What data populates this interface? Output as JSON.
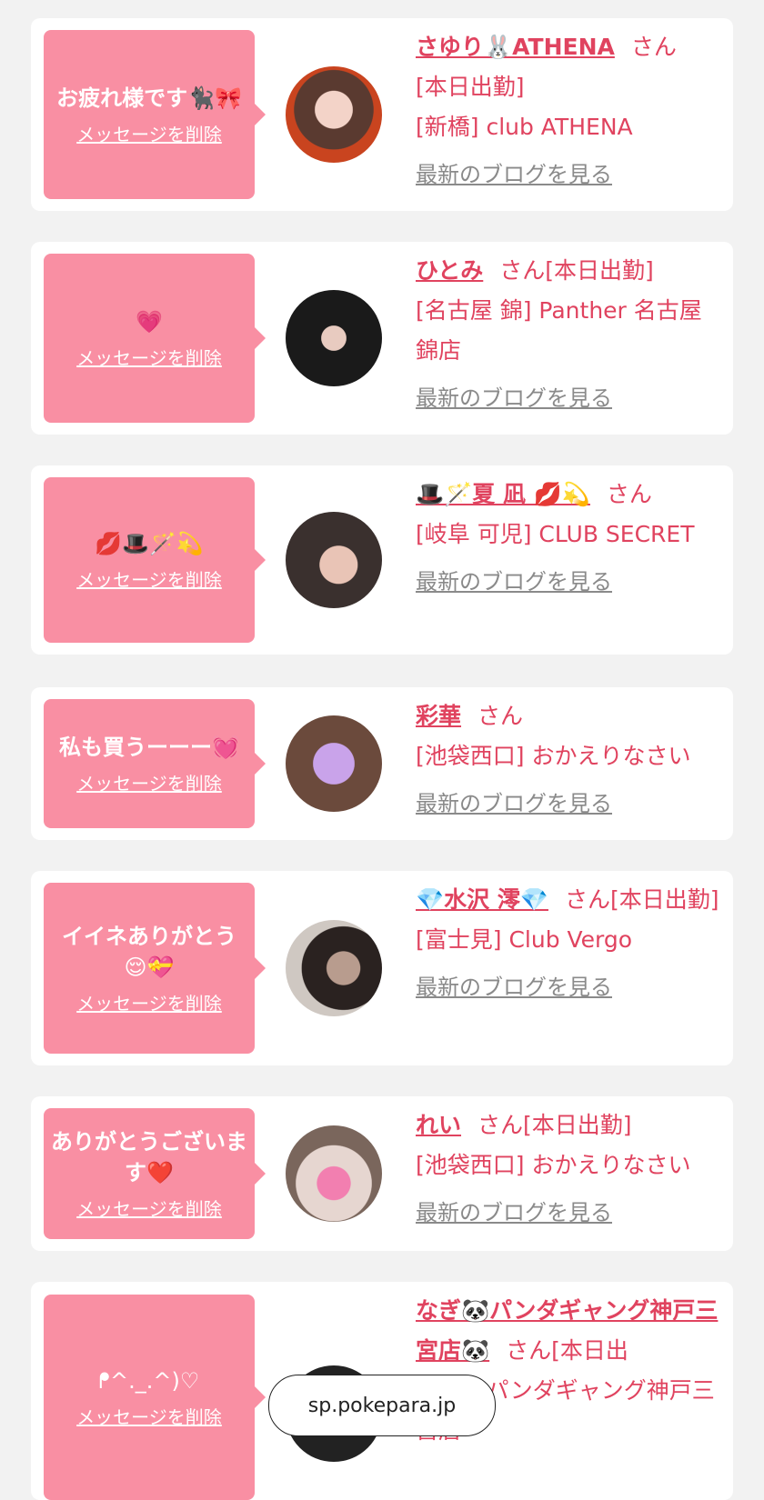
{
  "delete_label": "メッセージを削除",
  "blog_label": "最新のブログを見る",
  "san": "さん",
  "url": "sp.pokepara.jp",
  "cards": [
    {
      "message": "お疲れ様です🐈‍⬛🎀",
      "name": "さゆり🐰ATHENA",
      "status": "[本日出勤]",
      "shop": "[新橋] club ATHENA"
    },
    {
      "message": "💗",
      "name": "ひとみ",
      "status": "[本日出勤]",
      "shop": "[名古屋 錦] Panther 名古屋錦店"
    },
    {
      "message": "💋🎩🪄💫",
      "name": "🎩🪄夏 凪 💋💫",
      "status": "",
      "shop": "[岐阜 可児] CLUB SECRET"
    },
    {
      "message": "私も買うーーー💓",
      "name": "彩華",
      "status": "",
      "shop": "[池袋西口] おかえりなさい"
    },
    {
      "message": "イイネありがとう😌💝",
      "name": "💎水沢 澪💎",
      "status": "[本日出勤]",
      "shop": "[富士見] Club Vergo"
    },
    {
      "message": "ありがとうございます❤️",
      "name": "れい",
      "status": "[本日出勤]",
      "shop": "[池袋西口] おかえりなさい"
    },
    {
      "message": "ᖰ^._.^)♡",
      "name": "なぎ🐼パンダギャング神戸三宮店🐼",
      "status": "[本日出",
      "shop": "[三宮] パンダギャング神戸三宮店"
    }
  ]
}
